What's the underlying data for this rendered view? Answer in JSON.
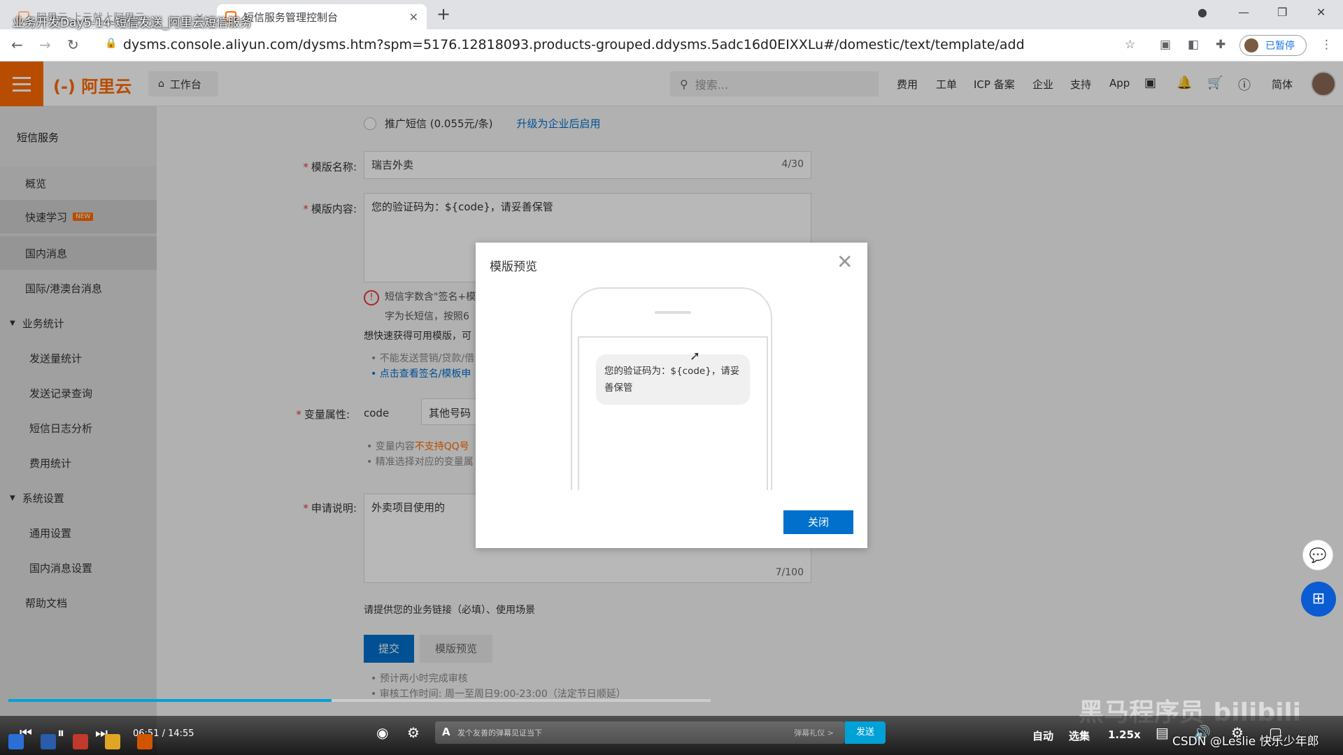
{
  "video_title": "业务开发Day5-14-短信发送_阿里云短信服务",
  "browser": {
    "tabs": [
      {
        "label": "阿里云-上云就上阿里云"
      },
      {
        "label": "短信服务管理控制台"
      }
    ],
    "url": "dysms.console.aliyun.com/dysms.htm?spm=5176.12818093.products-grouped.ddysms.5adc16d0EIXXLu#/domestic/text/template/add",
    "profile_status": "已暂停"
  },
  "header": {
    "logo": "(-) 阿里云",
    "workbench": "工作台",
    "search_placeholder": "搜索...",
    "nav": [
      "费用",
      "工单",
      "ICP 备案",
      "企业",
      "支持",
      "App"
    ],
    "lang": "简体"
  },
  "sidebar": {
    "title": "短信服务",
    "items": [
      {
        "label": "概览"
      },
      {
        "label": "快速学习",
        "badge": "NEW"
      },
      {
        "label": "国内消息"
      },
      {
        "label": "国际/港澳台消息"
      },
      {
        "label": "业务统计"
      },
      {
        "label": "发送量统计"
      },
      {
        "label": "发送记录查询"
      },
      {
        "label": "短信日志分析"
      },
      {
        "label": "费用统计"
      },
      {
        "label": "系统设置"
      },
      {
        "label": "通用设置"
      },
      {
        "label": "国内消息设置"
      },
      {
        "label": "帮助文档"
      }
    ]
  },
  "form": {
    "promo_option": "推广短信 (0.055元/条)",
    "upgrade_link": "升级为企业后启用",
    "name_label": "模版名称",
    "name_value": "瑞吉外卖",
    "name_count": "4/30",
    "content_label": "模版内容",
    "content_value": "您的验证码为：${code}，请妥善保管",
    "warning_line1": "短信字数含\"签名+模",
    "warning_line2": "字为长短信，按照6",
    "quick_text": "想快速获得可用模版，可",
    "bullet1": "不能发送营销/贷款/借",
    "bullet2": "点击查看签名/模板申",
    "var_label": "变量属性",
    "var_name": "code",
    "var_type": "其他号码",
    "var_bullet1_pre": "变量内容",
    "var_bullet1_orange": "不支持QQ号",
    "var_bullet2": "精准选择对应的变量属",
    "desc_label": "申请说明",
    "desc_value": "外卖项目使用的",
    "desc_count": "7/100",
    "business_hint": "请提供您的业务链接（必填）、使用场景",
    "submit": "提交",
    "preview": "模版预览",
    "footer1": "预计两小时完成审核",
    "footer2": "审核工作时间: 周一至周日9:00-23:00（法定节日顺延）"
  },
  "modal": {
    "title": "模版预览",
    "message": "您的验证码为：${code}，请妥善保管",
    "close_button": "关闭"
  },
  "player": {
    "time": "06:51 / 14:55",
    "progress": 0.46,
    "danmu_placeholder": "发个友善的弹幕见证当下",
    "danmu_etiquette": "弹幕礼仪 >",
    "send": "发送",
    "auto": "自动",
    "episodes": "选集",
    "speed": "1.25x",
    "watermark": "黑马程序员 bilibili",
    "credit": "CSDN @Leslie 快乐少年郎"
  },
  "colors": {
    "brand": "#ff6a00",
    "primary": "#0070cc",
    "bili": "#00a1d6"
  }
}
